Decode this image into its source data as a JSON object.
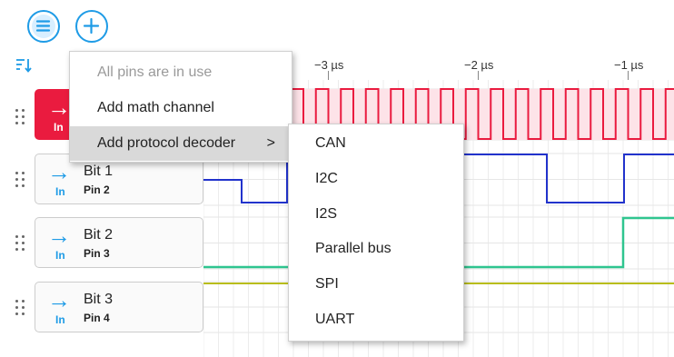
{
  "toolbar": {
    "menu_icon": "hamburger-circle-icon",
    "add_icon": "plus-circle-icon",
    "sort_icon": "sort-icon"
  },
  "ruler": {
    "labels": [
      "−3 µs",
      "−2 µs",
      "−1 µs"
    ]
  },
  "channels": [
    {
      "name": "",
      "pin": "",
      "dir": "In",
      "active": true,
      "color": "#ea1b3f"
    },
    {
      "name": "Bit 1",
      "pin": "Pin 2",
      "dir": "In",
      "active": false,
      "color": "#2233cc"
    },
    {
      "name": "Bit 2",
      "pin": "Pin 3",
      "dir": "In",
      "active": false,
      "color": "#2fc58f"
    },
    {
      "name": "Bit 3",
      "pin": "Pin 4",
      "dir": "In",
      "active": false,
      "color": "#b8bd18"
    }
  ],
  "context_menu": {
    "items": [
      {
        "label": "All pins are in use",
        "disabled": true
      },
      {
        "label": "Add math channel",
        "disabled": false
      },
      {
        "label": "Add protocol decoder",
        "disabled": false,
        "submenu": true,
        "chevron": ">"
      }
    ]
  },
  "protocol_submenu": {
    "items": [
      "CAN",
      "I2C",
      "I2S",
      "Parallel bus",
      "SPI",
      "UART"
    ]
  },
  "colors": {
    "accent": "#1e9be6",
    "active_channel": "#ea1b3f"
  }
}
